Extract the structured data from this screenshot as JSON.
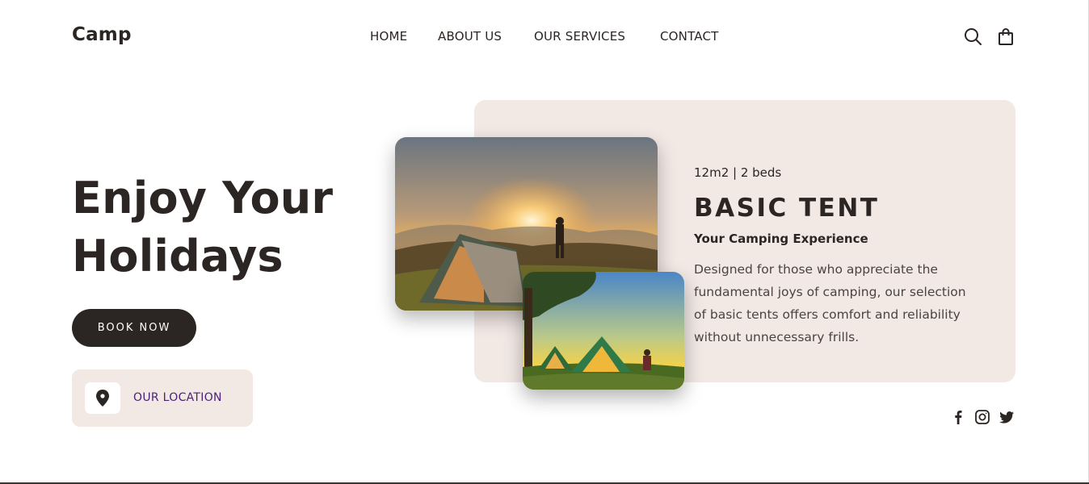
{
  "header": {
    "logo": "Camp",
    "nav": [
      "HOME",
      "ABOUT US",
      "OUR SERVICES",
      "CONTACT"
    ],
    "icons": [
      "search-icon",
      "shopping-bag-icon"
    ]
  },
  "hero": {
    "title_line1": "Enjoy Your",
    "title_line2": "Holidays",
    "book_button": "BOOK NOW",
    "location_label": "OUR LOCATION",
    "location_icon": "map-pin-icon"
  },
  "tent_card": {
    "meta": "12m2 | 2 beds",
    "title": "BASIC TENT",
    "subtitle": "Your Camping Experience",
    "description": "Designed for those who appreciate the fundamental joys of camping, our selection of basic tents offers comfort and reliability without unnecessary frills."
  },
  "social_icons": [
    "facebook-icon",
    "instagram-icon",
    "twitter-icon"
  ],
  "colors": {
    "text_dark": "#2b2523",
    "card_bg": "#f2e8e4",
    "location_text": "#4b2277",
    "button_bg": "#2b2523"
  }
}
